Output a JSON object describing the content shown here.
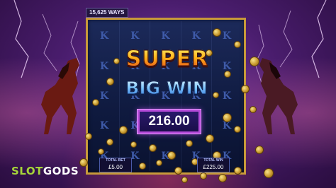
{
  "game": {
    "ways_label": "15,625 WAYS",
    "banner_line1": "SUPER",
    "banner_line2": "BIG WIN",
    "win_amount": "216.00"
  },
  "reels": {
    "symbols": [
      [
        "K",
        "K",
        "K",
        "K",
        "K"
      ],
      [
        "K",
        "K",
        "K",
        "K",
        "K"
      ],
      [
        "K",
        "K",
        "K",
        "K",
        "K"
      ],
      [
        "K",
        "K",
        "K",
        "K",
        "K"
      ],
      [
        "K",
        "K",
        "K",
        "K",
        "K"
      ]
    ]
  },
  "footer": {
    "total_bet_label": "TOTAL BET",
    "total_bet_value": "£5.00",
    "total_win_label": "TOTAL WIN",
    "total_win_value": "£225.00"
  },
  "branding": {
    "logo_part1": "SLOT",
    "logo_part2": "GODS"
  },
  "colors": {
    "frame_gold": "#c89a3a",
    "win_border": "#b44ad8",
    "logo_green": "#a6d43a"
  }
}
